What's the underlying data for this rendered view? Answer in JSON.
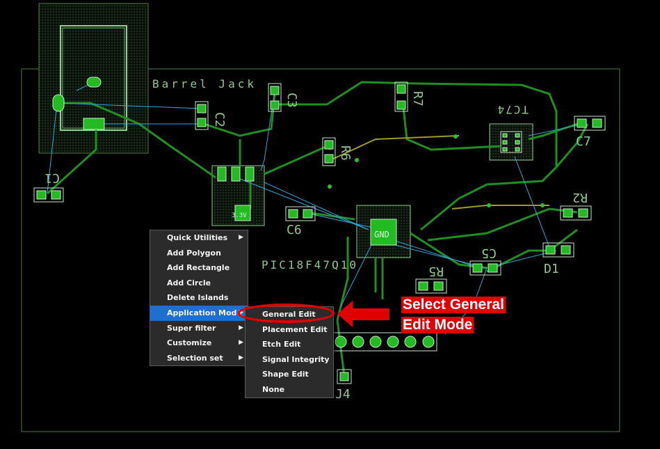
{
  "board": {
    "labels": {
      "barrel_jack": "Barrel Jack",
      "c1": "C1",
      "c2": "C2",
      "c3": "C3",
      "c5": "C5",
      "c6": "C6",
      "c7": "C7",
      "r2": "R2",
      "r5": "R5",
      "r6": "R6",
      "r7": "R7",
      "d1": "D1",
      "j4": "J4",
      "tc74": "TC74",
      "mcu": "PIC18F47Q10",
      "gnd": "GND",
      "v33": "3.3V"
    },
    "colors": {
      "trace": "#1f8f1f",
      "ratsnest": "#2fa8d8",
      "pad": "#22bb22",
      "outline": "#4c7a3c",
      "silk": "#8fc88f"
    }
  },
  "context_menu": {
    "items": [
      {
        "label": "Quick Utilities",
        "submenu": true
      },
      {
        "label": "Add Polygon",
        "submenu": false
      },
      {
        "label": "Add Rectangle",
        "submenu": false
      },
      {
        "label": "Add Circle",
        "submenu": false
      },
      {
        "label": "Delete Islands",
        "submenu": false
      },
      {
        "label": "Application Mode",
        "submenu": true
      },
      {
        "label": "Super filter",
        "submenu": true
      },
      {
        "label": "Customize",
        "submenu": true
      },
      {
        "label": "Selection set",
        "submenu": true
      }
    ],
    "selected": "Application Mode",
    "submenu_arrow": "▶"
  },
  "submenu": {
    "items": [
      {
        "label": "General Edit"
      },
      {
        "label": "Placement Edit"
      },
      {
        "label": "Etch Edit"
      },
      {
        "label": "Signal Integrity"
      },
      {
        "label": "Shape Edit"
      },
      {
        "label": "None"
      }
    ],
    "highlighted": "General Edit"
  },
  "callout": {
    "line1": "Select General",
    "line2": "Edit Mode",
    "color": "#e00000"
  }
}
